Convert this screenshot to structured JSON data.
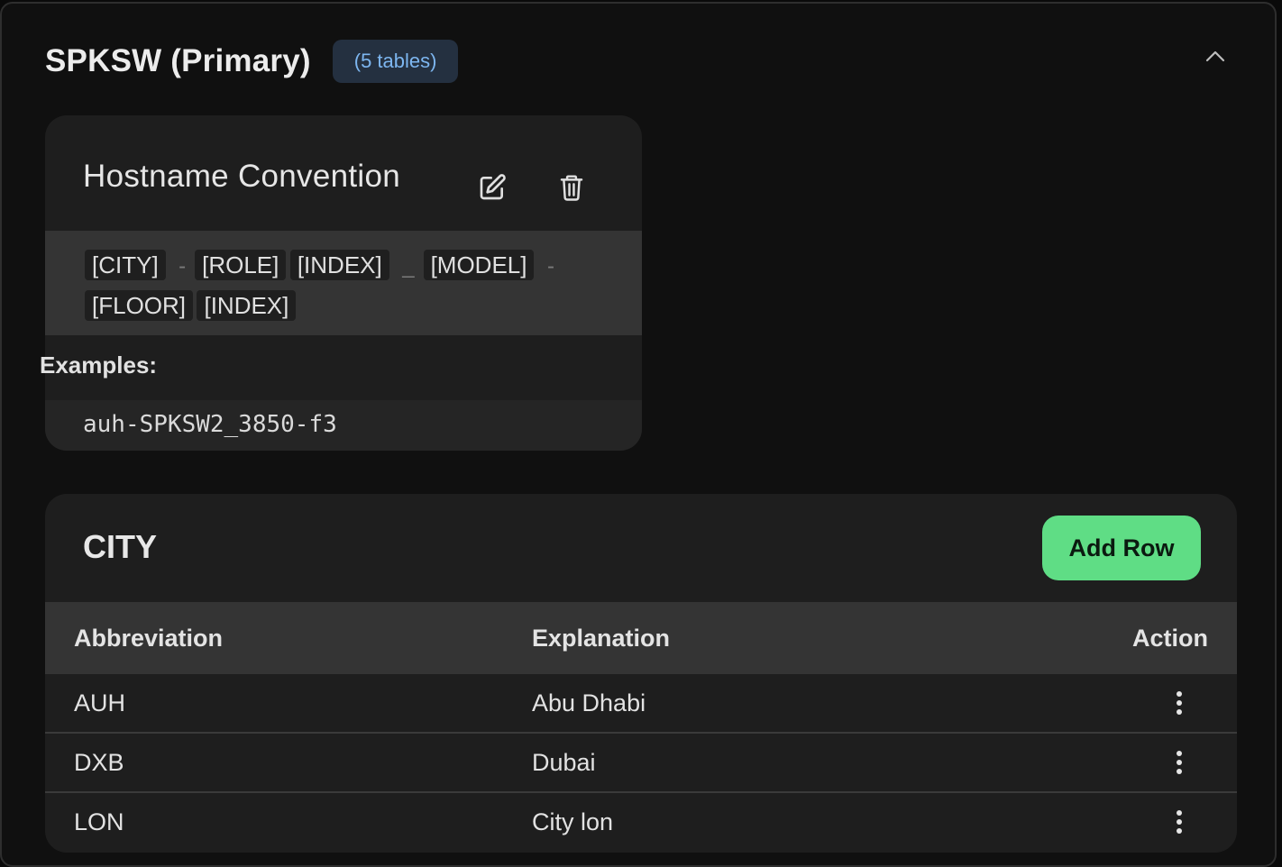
{
  "section": {
    "title": "SPKSW (Primary)",
    "badge": "(5 tables)",
    "collapse_icon": "chevron-up-icon"
  },
  "convention": {
    "title": "Hostname Convention",
    "edit_icon": "edit-icon",
    "delete_icon": "trash-icon",
    "pattern": [
      {
        "kind": "token",
        "text": "[CITY]"
      },
      {
        "kind": "sep",
        "text": "-"
      },
      {
        "kind": "token",
        "text": "[ROLE]"
      },
      {
        "kind": "token",
        "text": "[INDEX]"
      },
      {
        "kind": "sep",
        "text": "_"
      },
      {
        "kind": "token",
        "text": "[MODEL]"
      },
      {
        "kind": "sep",
        "text": "-"
      },
      {
        "kind": "token",
        "text": "[FLOOR]"
      },
      {
        "kind": "token",
        "text": "[INDEX]"
      }
    ],
    "examples_label": "Examples:",
    "example_value": "auh-SPKSW2_3850-f3"
  },
  "city_table": {
    "title": "CITY",
    "add_row_label": "Add Row",
    "columns": {
      "abbreviation": "Abbreviation",
      "explanation": "Explanation",
      "action": "Action"
    },
    "rows": [
      {
        "abbreviation": "AUH",
        "explanation": "Abu Dhabi"
      },
      {
        "abbreviation": "DXB",
        "explanation": "Dubai"
      },
      {
        "abbreviation": "LON",
        "explanation": "City lon"
      }
    ]
  },
  "colors": {
    "accent_green": "#5fdd85",
    "badge_text": "#7db6f0",
    "badge_bg": "#243040"
  }
}
